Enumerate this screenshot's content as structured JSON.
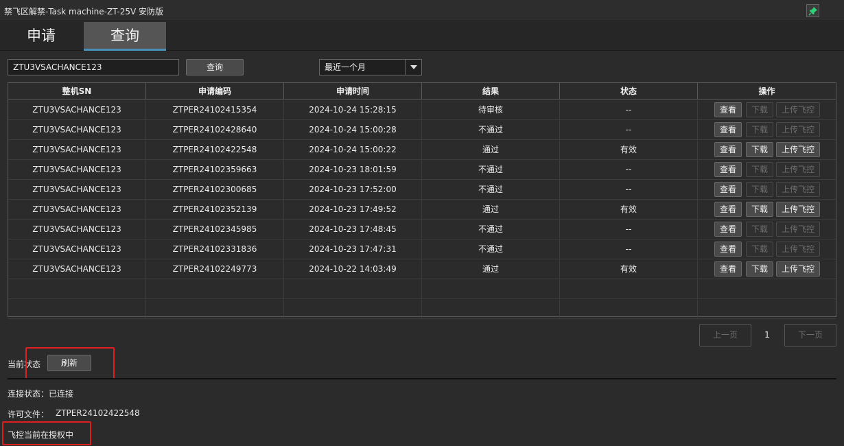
{
  "window": {
    "title": "禁飞区解禁-Task machine-ZT-25V 安防版"
  },
  "tabs": [
    {
      "label": "申请"
    },
    {
      "label": "查询"
    }
  ],
  "query": {
    "search_value": "ZTU3VSACHANCE123",
    "query_button": "查询",
    "range_selected": "最近一个月"
  },
  "table": {
    "headers": [
      "整机SN",
      "申请编码",
      "申请时间",
      "结果",
      "状态",
      "操作"
    ],
    "action_labels": {
      "view": "查看",
      "download": "下载",
      "upload": "上传飞控"
    },
    "rows": [
      {
        "sn": "ZTU3VSACHANCE123",
        "code": "ZTPER24102415354",
        "time": "2024-10-24 15:28:15",
        "result": "待审核",
        "status": "--",
        "enabled": false
      },
      {
        "sn": "ZTU3VSACHANCE123",
        "code": "ZTPER24102428640",
        "time": "2024-10-24 15:00:28",
        "result": "不通过",
        "status": "--",
        "enabled": false
      },
      {
        "sn": "ZTU3VSACHANCE123",
        "code": "ZTPER24102422548",
        "time": "2024-10-24 15:00:22",
        "result": "通过",
        "status": "有效",
        "enabled": true
      },
      {
        "sn": "ZTU3VSACHANCE123",
        "code": "ZTPER24102359663",
        "time": "2024-10-23 18:01:59",
        "result": "不通过",
        "status": "--",
        "enabled": false
      },
      {
        "sn": "ZTU3VSACHANCE123",
        "code": "ZTPER24102300685",
        "time": "2024-10-23 17:52:00",
        "result": "不通过",
        "status": "--",
        "enabled": false
      },
      {
        "sn": "ZTU3VSACHANCE123",
        "code": "ZTPER24102352139",
        "time": "2024-10-23 17:49:52",
        "result": "通过",
        "status": "有效",
        "enabled": true
      },
      {
        "sn": "ZTU3VSACHANCE123",
        "code": "ZTPER24102345985",
        "time": "2024-10-23 17:48:45",
        "result": "不通过",
        "status": "--",
        "enabled": false
      },
      {
        "sn": "ZTU3VSACHANCE123",
        "code": "ZTPER24102331836",
        "time": "2024-10-23 17:47:31",
        "result": "不通过",
        "status": "--",
        "enabled": false
      },
      {
        "sn": "ZTU3VSACHANCE123",
        "code": "ZTPER24102249773",
        "time": "2024-10-22 14:03:49",
        "result": "通过",
        "status": "有效",
        "enabled": true
      }
    ]
  },
  "pagination": {
    "prev": "上一页",
    "page": "1",
    "next": "下一页"
  },
  "status": {
    "label": "当前状态",
    "refresh_button": "刷新",
    "connection": "连接状态：已连接",
    "license_label": "许可文件：",
    "license_value": "ZTPER24102422548",
    "authorization": "飞控当前在授权中"
  },
  "icons": {
    "pin": "pin-icon",
    "dropdown": "chevron-down-icon"
  },
  "colors": {
    "accent": "#4a8fb8",
    "highlight": "#e02020",
    "pin": "#2fd07a"
  }
}
